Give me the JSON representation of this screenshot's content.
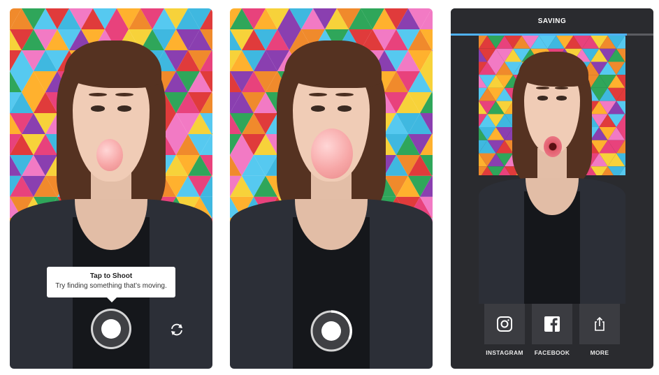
{
  "panel1": {
    "tooltip_title": "Tap to Shoot",
    "tooltip_text": "Try finding something that’s moving.",
    "shutter_icon": "shutter-button",
    "flip_icon": "flip-camera-icon"
  },
  "panel2": {
    "shutter_icon": "shutter-button-recording"
  },
  "panel3": {
    "header": "SAVING",
    "progress": 0.87,
    "share": [
      {
        "label": "INSTAGRAM",
        "icon": "instagram-icon"
      },
      {
        "label": "FACEBOOK",
        "icon": "facebook-icon"
      },
      {
        "label": "MORE",
        "icon": "share-icon"
      }
    ]
  },
  "colors": {
    "accent_progress": "#4fb1f2",
    "panel_bg": "#2a2b2f",
    "button_bg": "#3b3c41"
  }
}
